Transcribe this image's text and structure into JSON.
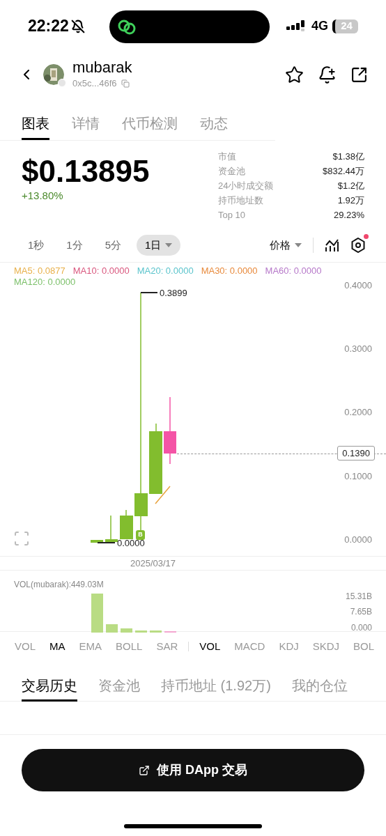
{
  "status_bar": {
    "time": "22:22",
    "network": "4G",
    "battery": "24"
  },
  "header": {
    "token_name": "mubarak",
    "address": "0x5c...46f6"
  },
  "tabs": [
    {
      "label": "图表",
      "selected": true
    },
    {
      "label": "详情",
      "selected": false
    },
    {
      "label": "代币检测",
      "selected": false
    },
    {
      "label": "动态",
      "selected": false
    }
  ],
  "price": {
    "value": "$0.13895",
    "change": "+13.80%"
  },
  "stats": [
    {
      "label": "市值",
      "value": "$1.38亿"
    },
    {
      "label": "资金池",
      "value": "$832.44万"
    },
    {
      "label": "24小时成交额",
      "value": "$1.2亿"
    },
    {
      "label": "持币地址数",
      "value": "1.92万"
    },
    {
      "label": "Top 10",
      "value": "29.23%"
    }
  ],
  "timeframes": [
    {
      "label": "1秒",
      "selected": false
    },
    {
      "label": "1分",
      "selected": false
    },
    {
      "label": "5分",
      "selected": false
    },
    {
      "label": "1日",
      "selected": true
    }
  ],
  "price_mode": "价格",
  "settings": {
    "alert": true
  },
  "chart": {
    "ma_legend": [
      {
        "label": "MA5: 0.0877",
        "color": "#e8b04a"
      },
      {
        "label": "MA10: 0.0000",
        "color": "#d9577e"
      },
      {
        "label": "MA20: 0.0000",
        "color": "#5bc4cc"
      },
      {
        "label": "MA30: 0.0000",
        "color": "#e88a3c"
      },
      {
        "label": "MA60: 0.0000",
        "color": "#b678c9"
      },
      {
        "label": "MA120: 0.0000",
        "color": "#7cc06a"
      }
    ],
    "y_axis_labels": [
      "0.4000",
      "0.3000",
      "0.2000",
      "0.1000",
      "0.0000"
    ],
    "high_label": "0.3899",
    "low_label": "0.0000",
    "current_price": "0.1390",
    "marker": "B",
    "date_label": "2025/03/17"
  },
  "volume": {
    "title": "VOL(mubarak):449.03M",
    "y_axis_labels": [
      "15.31B",
      "7.65B",
      "0.000"
    ]
  },
  "indicators": {
    "main": [
      {
        "label": "VOL",
        "selected": false
      },
      {
        "label": "MA",
        "selected": true
      },
      {
        "label": "EMA",
        "selected": false
      },
      {
        "label": "BOLL",
        "selected": false
      },
      {
        "label": "SAR",
        "selected": false
      }
    ],
    "sub": [
      {
        "label": "VOL",
        "selected": true
      },
      {
        "label": "MACD",
        "selected": false
      },
      {
        "label": "KDJ",
        "selected": false
      },
      {
        "label": "SKDJ",
        "selected": false
      },
      {
        "label": "BOL",
        "selected": false
      }
    ]
  },
  "bottom_tabs": [
    {
      "label": "交易历史",
      "selected": true
    },
    {
      "label": "资金池",
      "selected": false
    },
    {
      "label": "持币地址 (1.92万)",
      "selected": false
    },
    {
      "label": "我的仓位",
      "selected": false
    }
  ],
  "action_button": "使用 DApp 交易"
}
